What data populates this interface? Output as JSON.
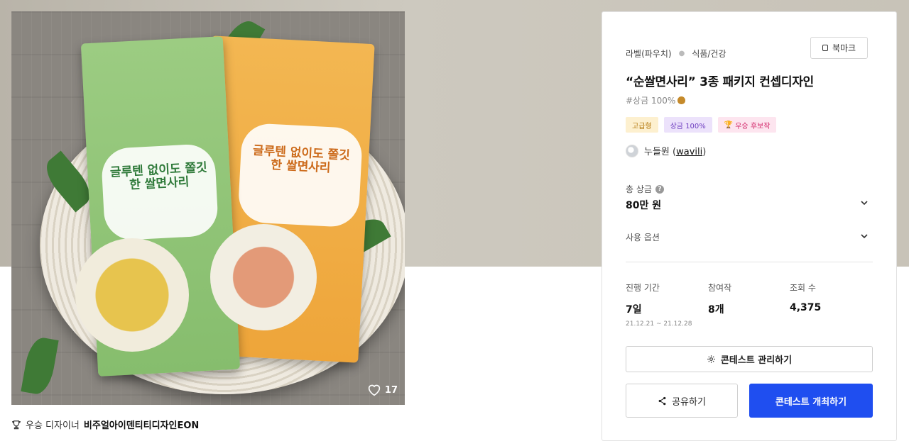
{
  "hero": {
    "like_count": "17",
    "green_pack_text": "글루텐 없이도 쫄깃한 쌀면사리",
    "orange_pack_text": "글루텐 없이도 쫄깃한 쌀면사리"
  },
  "designer": {
    "prefix": "우승 디자이너",
    "name": "비주얼아이덴티티디자인EON"
  },
  "card": {
    "category_1": "라벨(파우치)",
    "category_2": "식품/건강",
    "bookmark_label": "북마크",
    "title": "“순쌀면사리” 3종 패키지 컨셉디자인",
    "hashtag": "#상금 100%",
    "badges": [
      "고급형",
      "상금 100%",
      "우승 후보작"
    ],
    "host_name": "누들원 (",
    "host_handle": "wavili",
    "host_close": ")",
    "prize_label": "총 상금",
    "prize_value": "80만 원",
    "option_label": "사용 옵션",
    "stats": [
      {
        "label": "진행 기간",
        "value": "7일",
        "sub": "21.12.21 ~ 21.12.28"
      },
      {
        "label": "참여작",
        "value": "8개"
      },
      {
        "label": "조회 수",
        "value": "4,375"
      }
    ],
    "manage_label": "콘테스트 관리하기",
    "share_label": "공유하기",
    "host_button_label": "콘테스트 개최하기"
  },
  "colors": {
    "primary": "#1f4ef0",
    "badge_gold": "#b3770b",
    "badge_purple": "#6f3fc0",
    "badge_pink": "#d2286a"
  },
  "icons": [
    "heart-icon",
    "trophy-icon",
    "bookmark-icon",
    "coin-bag-icon",
    "question-icon",
    "chevron-down-icon",
    "gear-icon",
    "share-icon"
  ]
}
